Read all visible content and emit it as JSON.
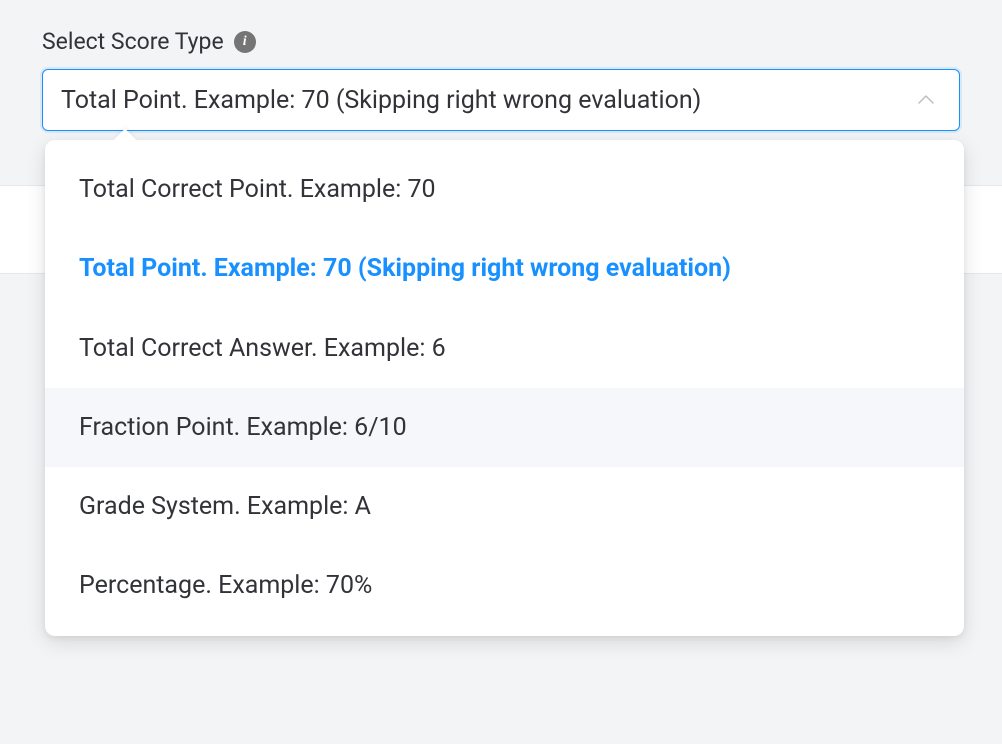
{
  "field": {
    "label": "Select Score Type",
    "selected_value": "Total Point. Example: 70 (Skipping right wrong evaluation)",
    "info_glyph": "i"
  },
  "options": [
    {
      "label": "Total Correct Point. Example: 70",
      "selected": false,
      "hovered": false
    },
    {
      "label": "Total Point. Example: 70 (Skipping right wrong evaluation)",
      "selected": true,
      "hovered": false
    },
    {
      "label": "Total Correct Answer. Example: 6",
      "selected": false,
      "hovered": false
    },
    {
      "label": "Fraction Point. Example: 6/10",
      "selected": false,
      "hovered": true
    },
    {
      "label": "Grade System. Example: A",
      "selected": false,
      "hovered": false
    },
    {
      "label": "Percentage. Example: 70%",
      "selected": false,
      "hovered": false
    }
  ]
}
